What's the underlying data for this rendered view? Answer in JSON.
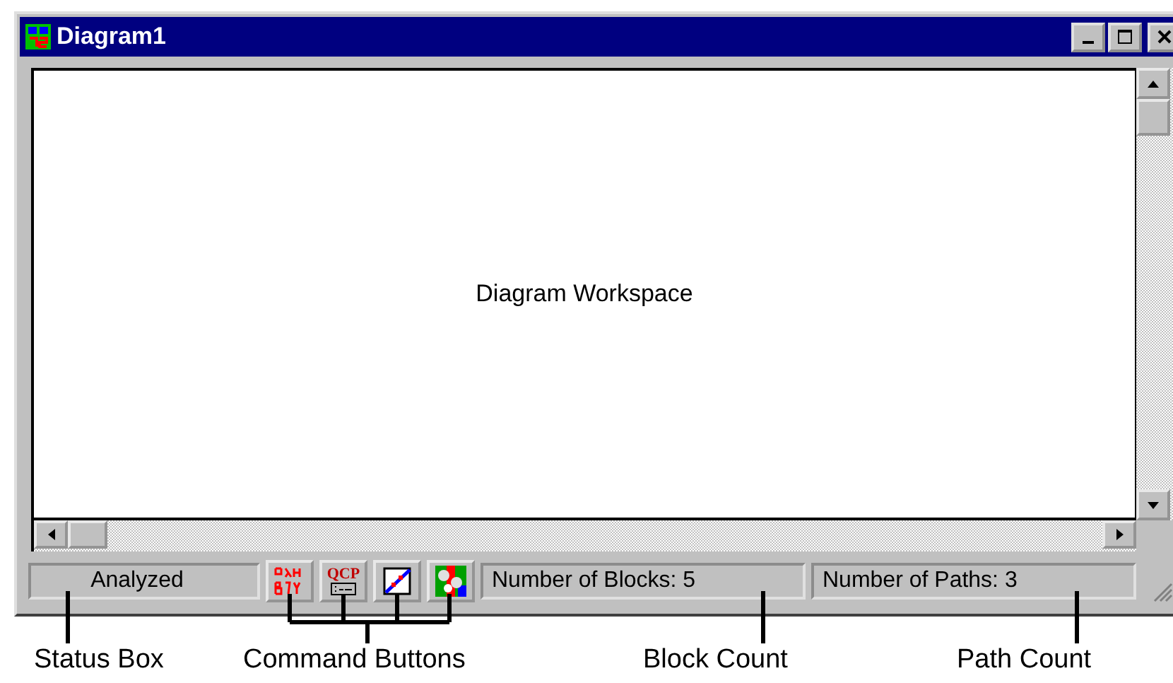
{
  "window": {
    "title": "Diagram1"
  },
  "workspace": {
    "label": "Diagram Workspace"
  },
  "status_bar": {
    "status": "Analyzed",
    "command_buttons": [
      {
        "kind": "greek"
      },
      {
        "kind": "qcp",
        "label": "QCP"
      },
      {
        "kind": "plot"
      },
      {
        "kind": "dice"
      }
    ],
    "block_count": "Number of Blocks: 5",
    "path_count": "Number of Paths: 3"
  },
  "annotations": [
    {
      "kind": "status",
      "label": "Status Box"
    },
    {
      "kind": "commands",
      "label": "Command Buttons"
    },
    {
      "kind": "blocks",
      "label": "Block Count"
    },
    {
      "kind": "paths",
      "label": "Path Count"
    }
  ]
}
